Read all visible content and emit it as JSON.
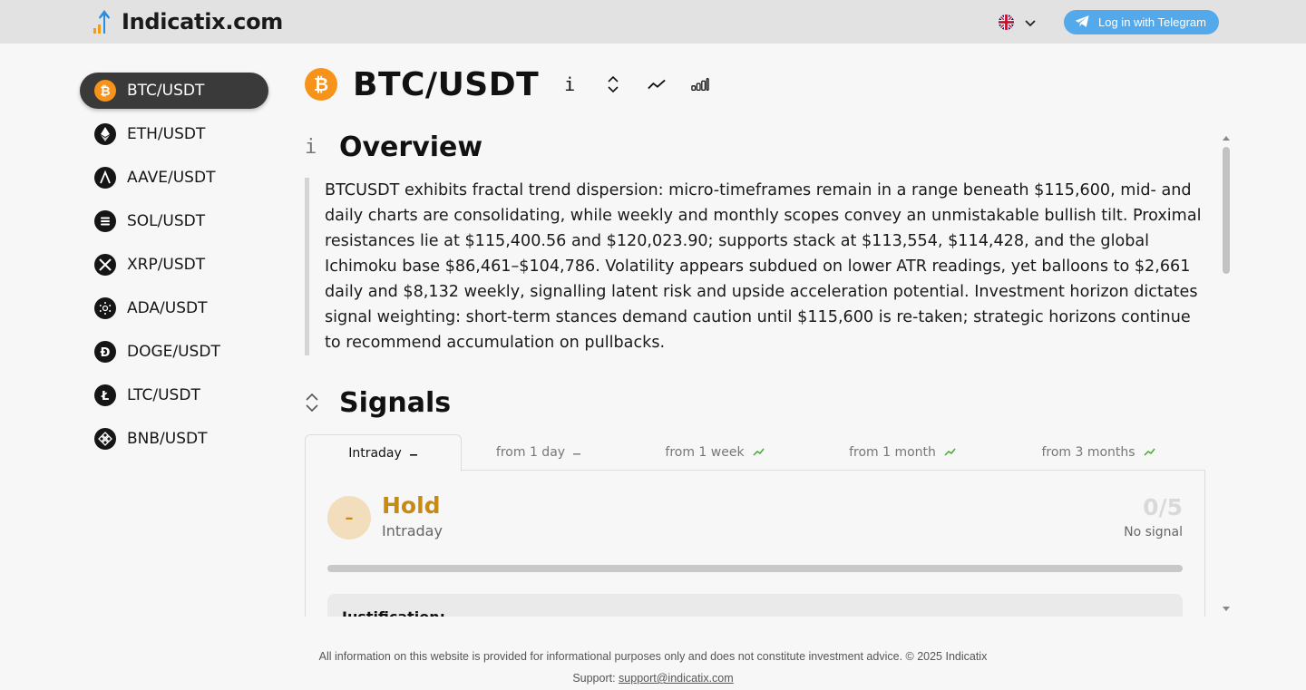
{
  "header": {
    "logo_text": "Indicatix.com",
    "language": "en-GB",
    "login_label": "Log in with Telegram"
  },
  "sidebar": {
    "items": [
      {
        "label": "BTC/USDT",
        "icon": "bitcoin-icon",
        "active": true
      },
      {
        "label": "ETH/USDT",
        "icon": "ethereum-icon"
      },
      {
        "label": "AAVE/USDT",
        "icon": "aave-icon"
      },
      {
        "label": "SOL/USDT",
        "icon": "solana-icon"
      },
      {
        "label": "XRP/USDT",
        "icon": "xrp-icon"
      },
      {
        "label": "ADA/USDT",
        "icon": "cardano-icon"
      },
      {
        "label": "DOGE/USDT",
        "icon": "dogecoin-icon"
      },
      {
        "label": "LTC/USDT",
        "icon": "litecoin-icon"
      },
      {
        "label": "BNB/USDT",
        "icon": "bnb-icon"
      }
    ]
  },
  "main": {
    "pair_title": "BTC/USDT",
    "header_icons": [
      "info-icon",
      "sort-icon",
      "trend-line-icon",
      "bar-signal-icon"
    ],
    "overview": {
      "title": "Overview",
      "icon_glyph": "i",
      "text": "BTCUSDT exhibits fractal trend dispersion: micro-timeframes remain in a range beneath $115,600, mid- and daily charts are consolidating, while weekly and monthly scopes convey an unmistakable bullish tilt. Proximal resistances lie at $115,400.56 and $120,023.90; supports stack at $113,554, $114,428, and the global Ichimoku base $86,461–$104,786. Volatility appears subdued on lower ATR readings, yet balloons to $2,661 daily and $8,132 weekly, signalling latent risk and upside acceleration potential. Investment horizon dictates signal weighting: short-term stances demand caution until $115,600 is re-taken; strategic horizons continue to recommend accumulation on pullbacks."
    },
    "signals": {
      "title": "Signals",
      "tabs": [
        {
          "label": "Intraday",
          "trend": "neutral",
          "active": true
        },
        {
          "label": "from 1 day",
          "trend": "neutral"
        },
        {
          "label": "from 1 week",
          "trend": "up"
        },
        {
          "label": "from 1 month",
          "trend": "up"
        },
        {
          "label": "from 3 months",
          "trend": "up"
        }
      ],
      "current": {
        "symbol": "–",
        "verdict": "Hold",
        "horizon": "Intraday",
        "score": "0/5",
        "score_fraction": 0,
        "score_label": "No signal",
        "justification_label": "Justification:"
      }
    }
  },
  "footer": {
    "disclaimer": "All information on this website is provided for informational purposes only and does not constitute investment advice. © 2025 Indicatix",
    "support_prefix": "Support: ",
    "support_email": "support@indicatix.com"
  },
  "colors": {
    "topbar": "#e2e2e2",
    "telegram": "#54a9eb",
    "bitcoin": "#f7931a",
    "hold": "#c98a12",
    "trend_up": "#3fae2a"
  }
}
